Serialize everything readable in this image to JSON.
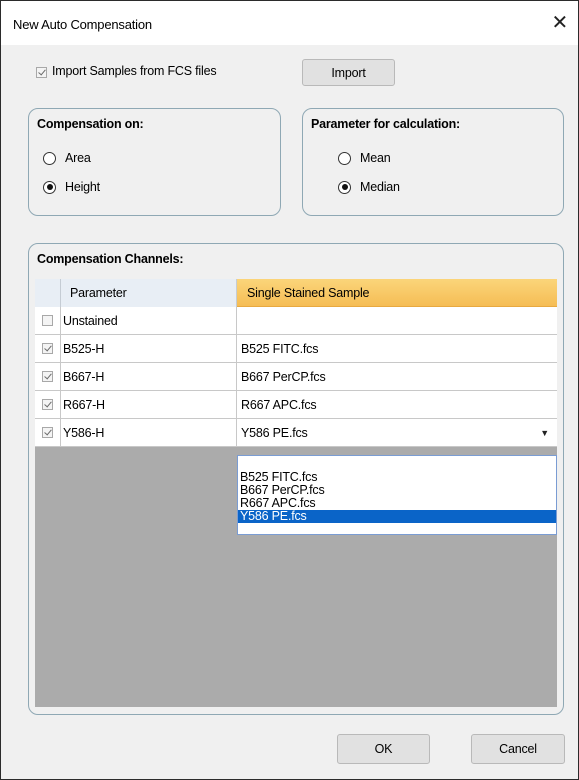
{
  "window": {
    "title": "New Auto Compensation",
    "close_symbol": "✕"
  },
  "import": {
    "checkbox_label": "Import Samples from FCS files",
    "checked": true,
    "button_label": "Import"
  },
  "compensation_on": {
    "title": "Compensation on:",
    "options": [
      {
        "label": "Area",
        "selected": false
      },
      {
        "label": "Height",
        "selected": true
      }
    ]
  },
  "parameter_for_calculation": {
    "title": "Parameter for calculation:",
    "options": [
      {
        "label": "Mean",
        "selected": false
      },
      {
        "label": "Median",
        "selected": true
      }
    ]
  },
  "channels": {
    "title": "Compensation Channels:",
    "columns": [
      "Parameter",
      "Single Stained Sample"
    ],
    "rows": [
      {
        "checked": false,
        "parameter": "Unstained",
        "sample": ""
      },
      {
        "checked": true,
        "parameter": "B525-H",
        "sample": "B525 FITC.fcs"
      },
      {
        "checked": true,
        "parameter": "B667-H",
        "sample": "B667 PerCP.fcs"
      },
      {
        "checked": true,
        "parameter": "R667-H",
        "sample": "R667 APC.fcs"
      },
      {
        "checked": true,
        "parameter": "Y586-H",
        "sample": "Y586 PE.fcs"
      }
    ],
    "dropdown_arrow": "▼",
    "dropdown_options": [
      "",
      "B525 FITC.fcs",
      "B667 PerCP.fcs",
      "R667 APC.fcs",
      "Y586 PE.fcs"
    ],
    "dropdown_selected_index": 4
  },
  "footer": {
    "ok_label": "OK",
    "cancel_label": "Cancel"
  }
}
